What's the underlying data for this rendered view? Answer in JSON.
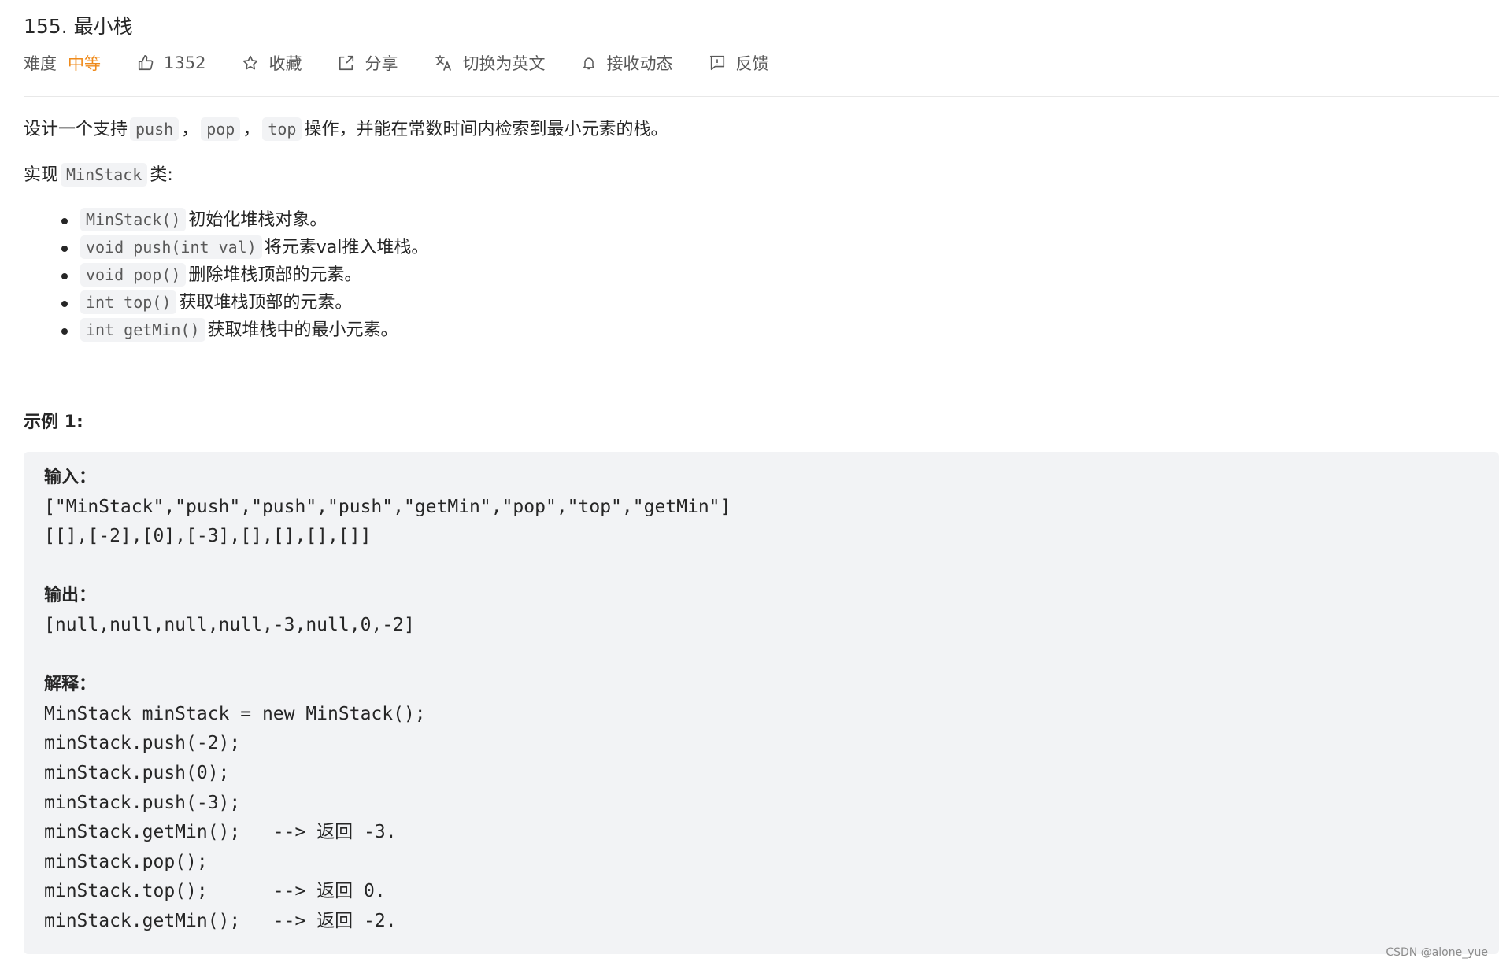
{
  "problem": {
    "title": "155. 最小栈"
  },
  "meta": {
    "difficulty_label": "难度",
    "difficulty_value": "中等",
    "likes": "1352",
    "favorite": "收藏",
    "share": "分享",
    "switch_lang": "切换为英文",
    "subscribe": "接收动态",
    "feedback": "反馈",
    "colors": {
      "difficulty": "#ef8a1a"
    }
  },
  "description": {
    "p1": {
      "prefix": "设计一个支持",
      "code1": "push",
      "sep1": "，",
      "code2": "pop",
      "sep2": "，",
      "code3": "top",
      "suffix": "操作，并能在常数时间内检索到最小元素的栈。"
    },
    "p2": {
      "prefix": "实现",
      "code": "MinStack",
      "suffix": "类:"
    },
    "methods": [
      {
        "code": "MinStack()",
        "desc": "初始化堆栈对象。"
      },
      {
        "code": "void push(int val)",
        "desc": "将元素val推入堆栈。"
      },
      {
        "code": "void pop()",
        "desc": "删除堆栈顶部的元素。"
      },
      {
        "code": "int top()",
        "desc": "获取堆栈顶部的元素。"
      },
      {
        "code": "int getMin()",
        "desc": "获取堆栈中的最小元素。"
      }
    ]
  },
  "example": {
    "title": "示例 1:",
    "input_label": "输入：",
    "input_line1": "[\"MinStack\",\"push\",\"push\",\"push\",\"getMin\",\"pop\",\"top\",\"getMin\"]",
    "input_line2": "[[],[-2],[0],[-3],[],[],[],[]]",
    "output_label": "输出：",
    "output_line": "[null,null,null,null,-3,null,0,-2]",
    "explain_label": "解释：",
    "explain_lines": [
      "MinStack minStack = new MinStack();",
      "minStack.push(-2);",
      "minStack.push(0);",
      "minStack.push(-3);",
      "minStack.getMin();   --> 返回 -3.",
      "minStack.pop();",
      "minStack.top();      --> 返回 0.",
      "minStack.getMin();   --> 返回 -2."
    ]
  },
  "watermark": "CSDN @alone_yue"
}
